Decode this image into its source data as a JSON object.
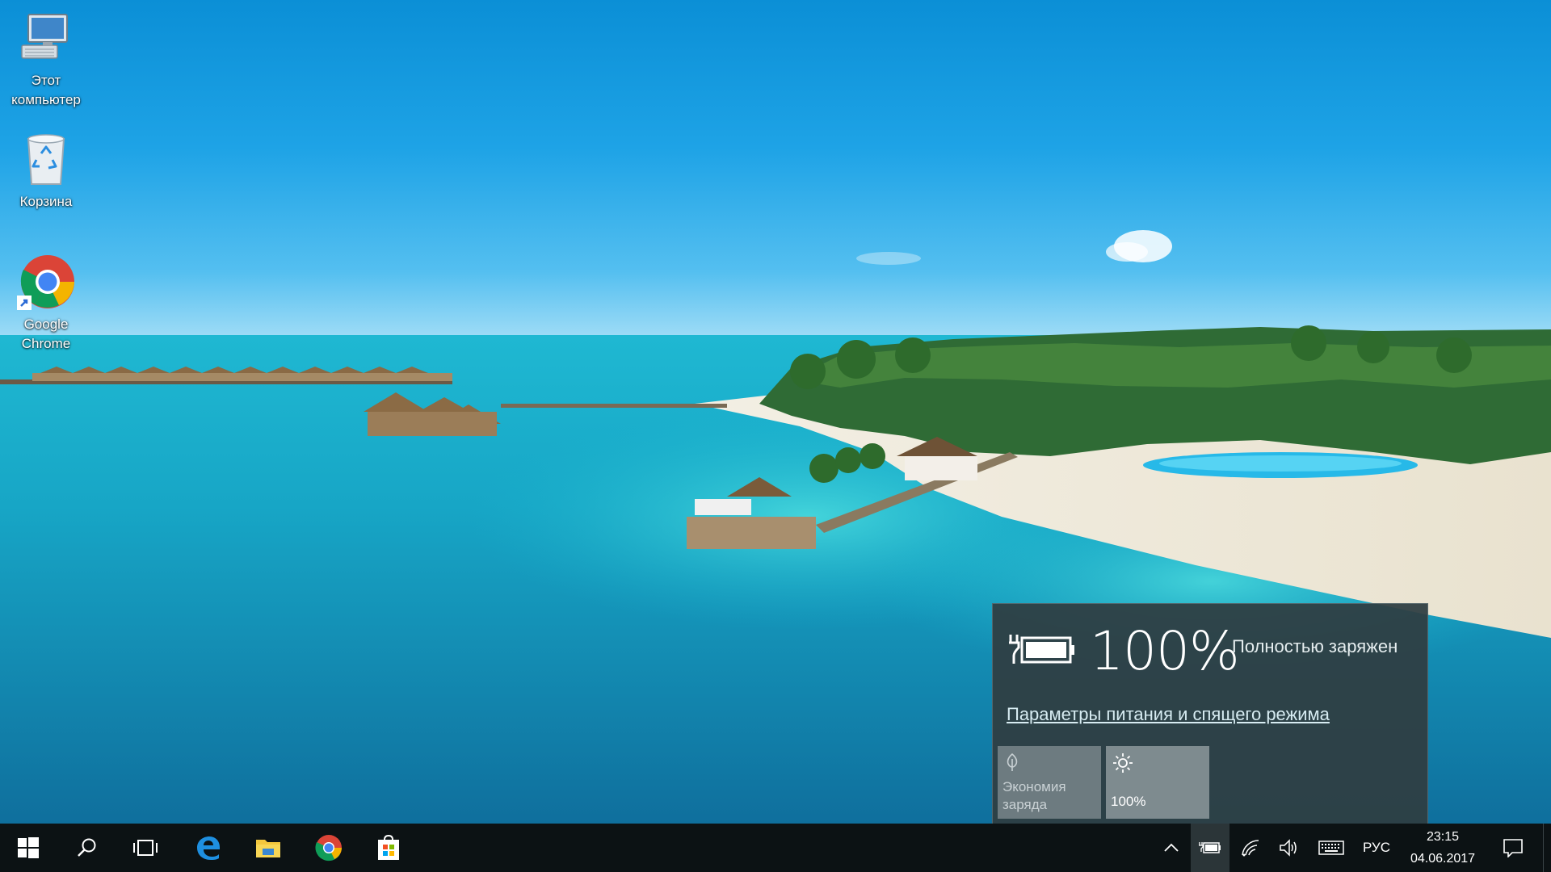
{
  "desktop": {
    "icons": [
      {
        "label": "Этот компьютер",
        "icon": "this-pc-icon"
      },
      {
        "label": "Корзина",
        "icon": "recycle-bin-icon"
      },
      {
        "label": "Google Chrome",
        "icon": "chrome-icon"
      }
    ]
  },
  "battery_flyout": {
    "percent": "100%",
    "status": "Полностью заряжен",
    "settings_link": "Параметры питания и спящего режима",
    "tiles": [
      {
        "label": "Экономия заряда",
        "icon": "leaf-icon",
        "enabled": false
      },
      {
        "label": "100%",
        "icon": "brightness-icon",
        "enabled": true
      }
    ]
  },
  "taskbar": {
    "pinned": [
      "start-icon",
      "search-icon",
      "task-view-icon",
      "edge-icon",
      "file-explorer-icon",
      "chrome-icon",
      "store-icon"
    ],
    "tray": {
      "language": "РУС",
      "time": "23:15",
      "date": "04.06.2017"
    }
  },
  "colors": {
    "taskbar": "#0c1214",
    "flyout_bg": "#2f3e42",
    "saver_tile": "#6d7b80",
    "brightness_tile": "#7e8b8f"
  }
}
